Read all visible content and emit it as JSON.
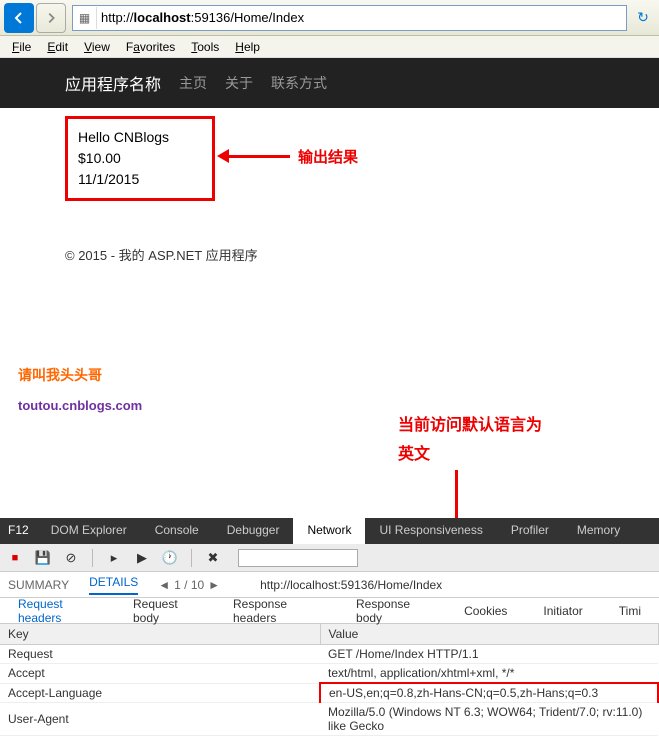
{
  "browser": {
    "url_prefix": "http://",
    "url_host": "localhost",
    "url_path": ":59136/Home/Index"
  },
  "menubar": [
    "File",
    "Edit",
    "View",
    "Favorites",
    "Tools",
    "Help"
  ],
  "nav": {
    "brand": "应用程序名称",
    "links": [
      "主页",
      "关于",
      "联系方式"
    ]
  },
  "output": {
    "line1": "Hello CNBlogs",
    "line2": "$10.00",
    "line3": "11/1/2015"
  },
  "annotation1": "输出结果",
  "footer": "© 2015 - 我的 ASP.NET 应用程序",
  "signature1": "请叫我头头哥",
  "signature2": "toutou.cnblogs.com",
  "annotation2_l1": "当前访问默认语言为",
  "annotation2_l2": "英文",
  "devtools": {
    "f12": "F12",
    "tabs": [
      "DOM Explorer",
      "Console",
      "Debugger",
      "Network",
      "UI Responsiveness",
      "Profiler",
      "Memory"
    ],
    "active_tab": 3,
    "summary": {
      "label1": "SUMMARY",
      "label2": "DETAILS",
      "pager": "1 / 10",
      "url": "http://localhost:59136/Home/Index"
    },
    "subtabs": [
      "Request headers",
      "Request body",
      "Response headers",
      "Response body",
      "Cookies",
      "Initiator",
      "Timi"
    ],
    "table": {
      "col1": "Key",
      "col2": "Value",
      "rows": [
        {
          "k": "Request",
          "v": "GET /Home/Index HTTP/1.1"
        },
        {
          "k": "Accept",
          "v": "text/html, application/xhtml+xml, */*"
        },
        {
          "k": "Accept-Language",
          "v": "en-US,en;q=0.8,zh-Hans-CN;q=0.5,zh-Hans;q=0.3"
        },
        {
          "k": "User-Agent",
          "v": "Mozilla/5.0 (Windows NT 6.3; WOW64; Trident/7.0; rv:11.0) like Gecko"
        }
      ]
    }
  }
}
